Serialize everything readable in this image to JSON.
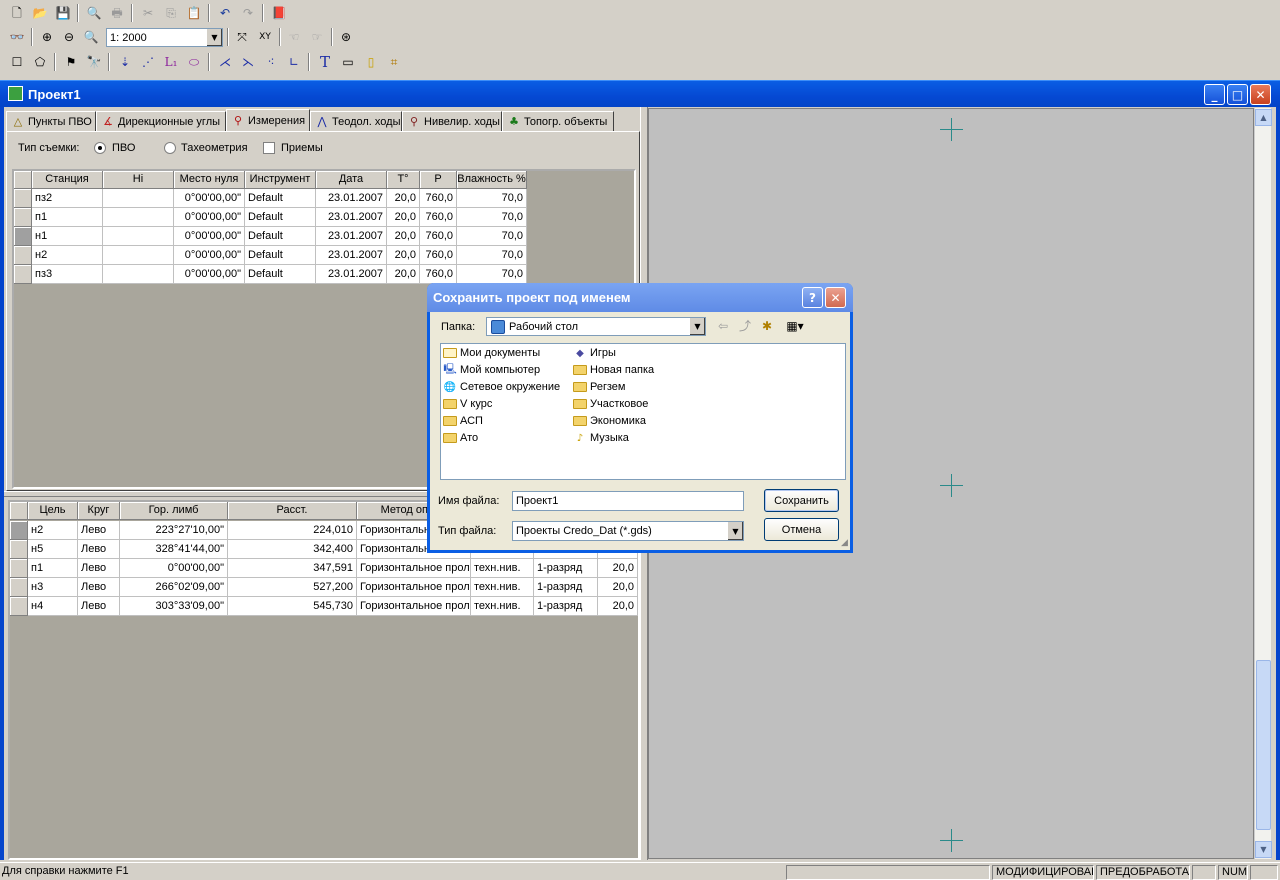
{
  "toolbar": {
    "scale": "1: 2000"
  },
  "window": {
    "title": "Проект1"
  },
  "tabs": [
    {
      "label": "Пункты ПВО",
      "icon": "triangle-points-icon"
    },
    {
      "label": "Дирекционные углы",
      "icon": "angle-icon"
    },
    {
      "label": "Измерения",
      "icon": "tripod-icon"
    },
    {
      "label": "Теодол. ходы",
      "icon": "traverse-icon"
    },
    {
      "label": "Нивелир. ходы",
      "icon": "level-icon"
    },
    {
      "label": "Топогр. объекты",
      "icon": "tree-icon"
    }
  ],
  "survey": {
    "type_label": "Тип съемки:",
    "option_pvo": "ПВО",
    "option_tacheo": "Тахеометрия",
    "option_tricks": "Приемы",
    "pvo_selected": true,
    "tricks_checked": false
  },
  "stations_table": {
    "headers": [
      "Станция",
      "Hi",
      "Место нуля",
      "Инструмент",
      "Дата",
      "T°",
      "P",
      "Влажность %"
    ],
    "rows": [
      [
        "пз2",
        "",
        "0°00'00,00\"",
        "Default",
        "23.01.2007",
        "20,0",
        "760,0",
        "70,0"
      ],
      [
        "п1",
        "",
        "0°00'00,00\"",
        "Default",
        "23.01.2007",
        "20,0",
        "760,0",
        "70,0"
      ],
      [
        "н1",
        "",
        "0°00'00,00\"",
        "Default",
        "23.01.2007",
        "20,0",
        "760,0",
        "70,0"
      ],
      [
        "н2",
        "",
        "0°00'00,00\"",
        "Default",
        "23.01.2007",
        "20,0",
        "760,0",
        "70,0"
      ],
      [
        "пз3",
        "",
        "0°00'00,00\"",
        "Default",
        "23.01.2007",
        "20,0",
        "760,0",
        "70,0"
      ]
    ]
  },
  "targets_table": {
    "headers": [
      "Цель",
      "Круг",
      "Гор. лимб",
      "Расст.",
      "Метод опред"
    ],
    "rows": [
      [
        "н2",
        "Лево",
        "223°27'10,00\"",
        "224,010",
        "Горизонтальн",
        "",
        "",
        ""
      ],
      [
        "н5",
        "Лево",
        "328°41'44,00\"",
        "342,400",
        "Горизонтальн",
        "",
        "",
        ""
      ],
      [
        "п1",
        "Лево",
        "0°00'00,00\"",
        "347,591",
        "Горизонтальное прол",
        "техн.нив.",
        "1-разряд",
        "20,0"
      ],
      [
        "н3",
        "Лево",
        "266°02'09,00\"",
        "527,200",
        "Горизонтальное прол",
        "техн.нив.",
        "1-разряд",
        "20,0"
      ],
      [
        "н4",
        "Лево",
        "303°33'09,00\"",
        "545,730",
        "Горизонтальное прол",
        "техн.нив.",
        "1-разряд",
        "20,0"
      ]
    ]
  },
  "dialog": {
    "title": "Сохранить проект под именем",
    "folder_label": "Папка:",
    "folder_value": "Рабочий стол",
    "files_col1": [
      {
        "name": "Мои документы",
        "icon": "my-documents-icon"
      },
      {
        "name": "Мой компьютер",
        "icon": "my-computer-icon"
      },
      {
        "name": "Сетевое окружение",
        "icon": "network-icon"
      },
      {
        "name": "V курс",
        "icon": "folder-icon"
      },
      {
        "name": "АСП",
        "icon": "folder-icon"
      },
      {
        "name": "Ато",
        "icon": "folder-icon"
      }
    ],
    "files_col2": [
      {
        "name": "Игры",
        "icon": "games-shortcut-icon"
      },
      {
        "name": "Новая папка",
        "icon": "folder-icon"
      },
      {
        "name": "Регзем",
        "icon": "folder-icon"
      },
      {
        "name": "Участковое",
        "icon": "folder-icon"
      },
      {
        "name": "Экономика",
        "icon": "folder-icon"
      },
      {
        "name": "Музыка",
        "icon": "music-shortcut-icon"
      }
    ],
    "filename_label": "Имя файла:",
    "filename_value": "Проект1",
    "filetype_label": "Тип файла:",
    "filetype_value": "Проекты Credo_Dat (*.gds)",
    "save_label": "Сохранить",
    "cancel_label": "Отмена"
  },
  "status": {
    "help": "Для справки  нажмите  F1",
    "modified": "МОДИФИЦИРОВАН",
    "preprocessed": "ПРЕДОБРАБОТАН",
    "num": "NUM"
  }
}
